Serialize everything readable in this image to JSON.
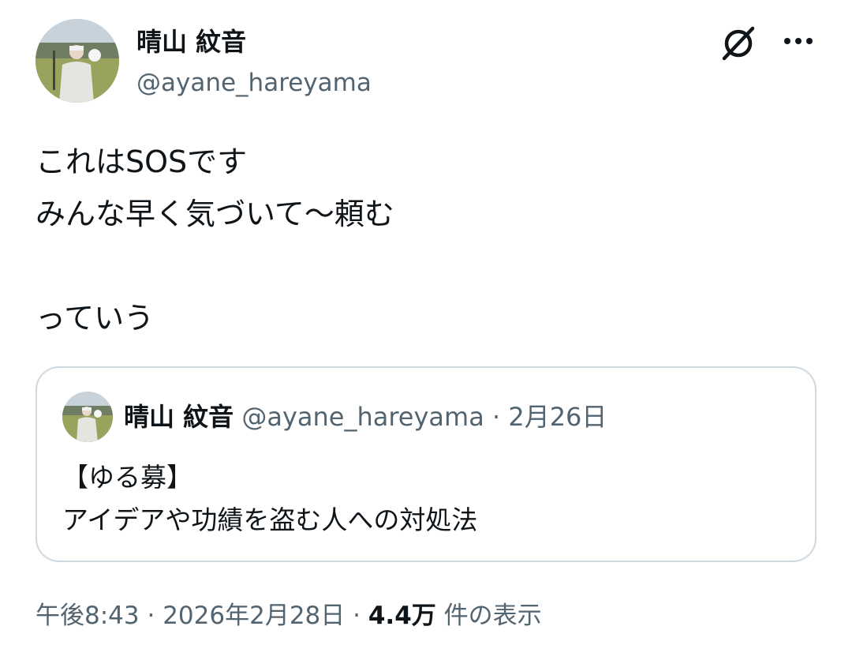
{
  "author": {
    "display_name": "晴山 紋音",
    "handle": "@ayane_hareyama"
  },
  "icons": {
    "grok": "grok-icon",
    "more": "more-options-icon"
  },
  "tweet": {
    "text": "これはSOSです\nみんな早く気づいて〜頼む\n\nっていう"
  },
  "quoted_tweet": {
    "display_name": "晴山 紋音",
    "handle": "@ayane_hareyama",
    "separator": "·",
    "date": "2月26日",
    "text": "【ゆる募】\nアイデアや功績を盗む人への対処法"
  },
  "meta": {
    "time": "午後8:43",
    "separator": "·",
    "date": "2026年2月28日",
    "views_count": "4.4万",
    "views_label": "件の表示"
  },
  "colors": {
    "text": "#0f1419",
    "secondary": "#536471",
    "border": "#cfd9de"
  }
}
